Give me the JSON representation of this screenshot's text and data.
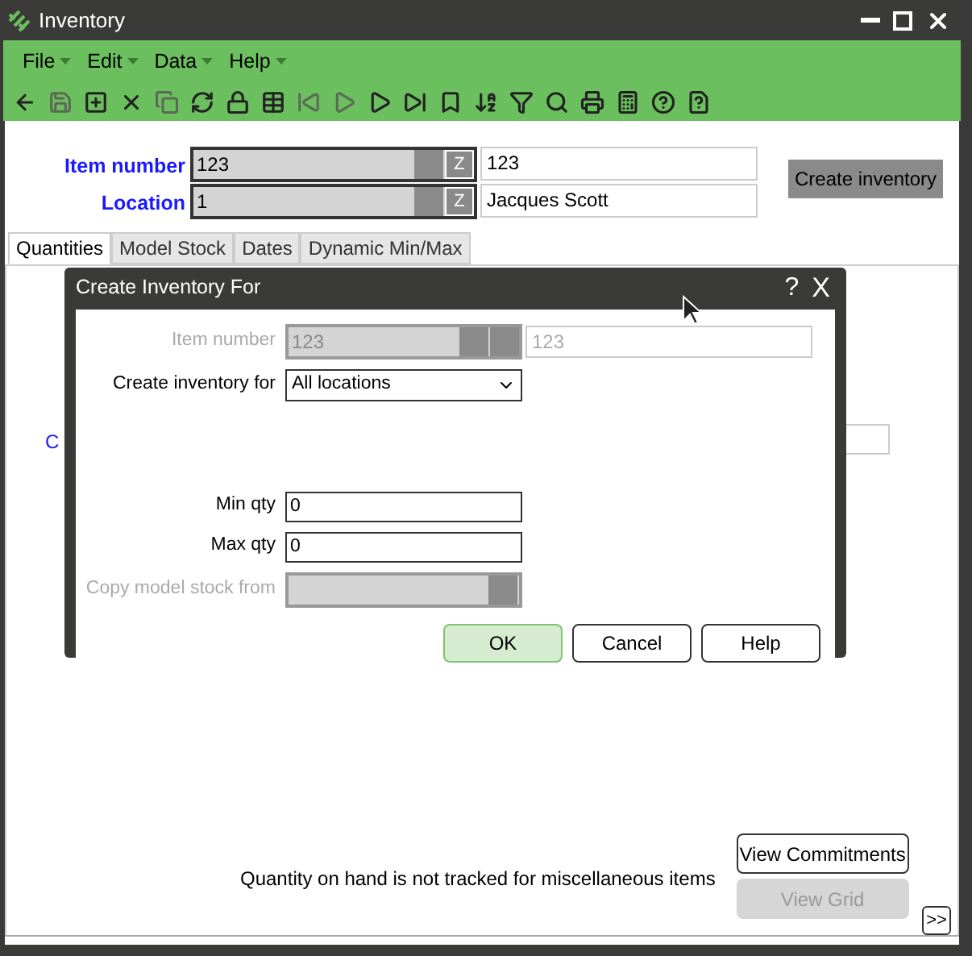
{
  "window": {
    "title": "Inventory"
  },
  "menu": [
    {
      "label": "File"
    },
    {
      "label": "Edit"
    },
    {
      "label": "Data"
    },
    {
      "label": "Help"
    }
  ],
  "header": {
    "item_label": "Item number",
    "item_value": "123",
    "item_description": "123",
    "item_lookup_glyph": "Z",
    "location_label": "Location",
    "location_value": "1",
    "location_description": "Jacques Scott",
    "location_lookup_glyph": "Z",
    "create_button": "Create inventory"
  },
  "tabs": [
    {
      "label": "Quantities",
      "selected": true
    },
    {
      "label": "Model Stock",
      "selected": false
    },
    {
      "label": "Dates",
      "selected": false
    },
    {
      "label": "Dynamic Min/Max",
      "selected": false
    }
  ],
  "partial_label": "C",
  "note": "Quantity on hand is not tracked for miscellaneous items",
  "buttons": [
    {
      "label": "View Commitments",
      "disabled": false
    },
    {
      "label": "View Grid",
      "disabled": true
    }
  ],
  "more_button": ">>",
  "dialog": {
    "title": "Create Inventory For",
    "help_glyph": "?",
    "close_glyph": "X",
    "fields": [
      {
        "kind": "lookup",
        "label": "Item number",
        "value": "123",
        "description": "123",
        "disabled": true
      },
      {
        "kind": "select",
        "label": "Create inventory for",
        "value": "All locations",
        "disabled": false
      },
      {
        "kind": "spacer"
      },
      {
        "kind": "text",
        "label": "Min qty",
        "value": "0",
        "disabled": false
      },
      {
        "kind": "text",
        "label": "Max qty",
        "value": "0",
        "disabled": false
      },
      {
        "kind": "lookup",
        "label": "Copy model stock from",
        "disabled": true
      }
    ],
    "buttons": [
      {
        "label": "OK",
        "default": true
      },
      {
        "label": "Cancel",
        "default": false
      },
      {
        "label": "Help",
        "default": false
      }
    ]
  }
}
